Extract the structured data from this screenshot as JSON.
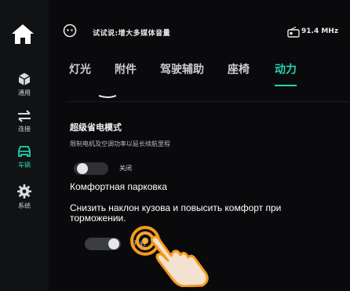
{
  "rail": {
    "items": [
      {
        "label": "通用",
        "icon": "package-icon"
      },
      {
        "label": "连接",
        "icon": "transfer-icon"
      },
      {
        "label": "车辆",
        "icon": "car-icon"
      },
      {
        "label": "系统",
        "icon": "gear-icon"
      }
    ]
  },
  "topbar": {
    "status_text": "试试说:增大多媒体音量",
    "radio_text": "91.4 MHz"
  },
  "tabs": [
    "灯光",
    "附件",
    "驾驶辅助",
    "座椅",
    "动力"
  ],
  "active_tab": "动力",
  "setting1": {
    "title": "超级省电模式",
    "description": "限制电机及空调功率以延长续航里程",
    "state_label": "关闭"
  },
  "subtitle": {
    "line1": "Комфортная парковка",
    "line2": "Снизить наклон кузова и повысить комфорт при торможении."
  },
  "setting2": {
    "state_label": "开启"
  },
  "colors": {
    "accent": "#22d3b1",
    "background": "#0a0a0c",
    "rail": "#111214",
    "ring": "#f59a1a"
  }
}
